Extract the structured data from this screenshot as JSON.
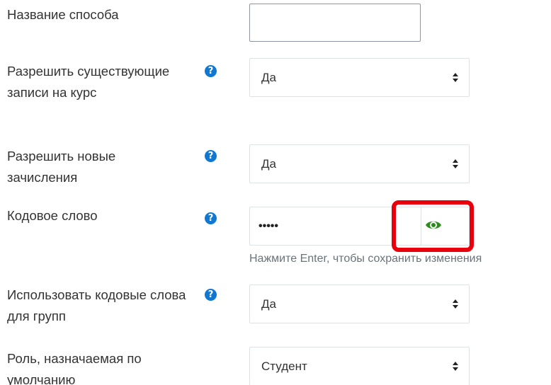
{
  "form": {
    "method_name": {
      "label": "Название способа",
      "value": ""
    },
    "allow_existing": {
      "label": "Разрешить существующие записи на курс",
      "help_icon": "question-circle-icon",
      "value": "Да"
    },
    "allow_new": {
      "label": "Разрешить новые зачисления",
      "help_icon": "question-circle-icon",
      "value": "Да"
    },
    "enrolment_key": {
      "label": "Кодовое слово",
      "help_icon": "question-circle-icon",
      "value": "•••••",
      "reveal_icon": "eye-icon",
      "hint": "Нажмите Enter, чтобы сохранить изменения"
    },
    "group_keys": {
      "label": "Использовать кодовые слова для групп",
      "help_icon": "question-circle-icon",
      "value": "Да"
    },
    "default_role": {
      "label": "Роль, назначаемая по умолчанию",
      "value": "Студент"
    }
  },
  "colors": {
    "help_icon": "#1177d1",
    "eye_icon": "#2e8b1f",
    "highlight": "#e8000d",
    "hint_text": "#6a737b"
  }
}
